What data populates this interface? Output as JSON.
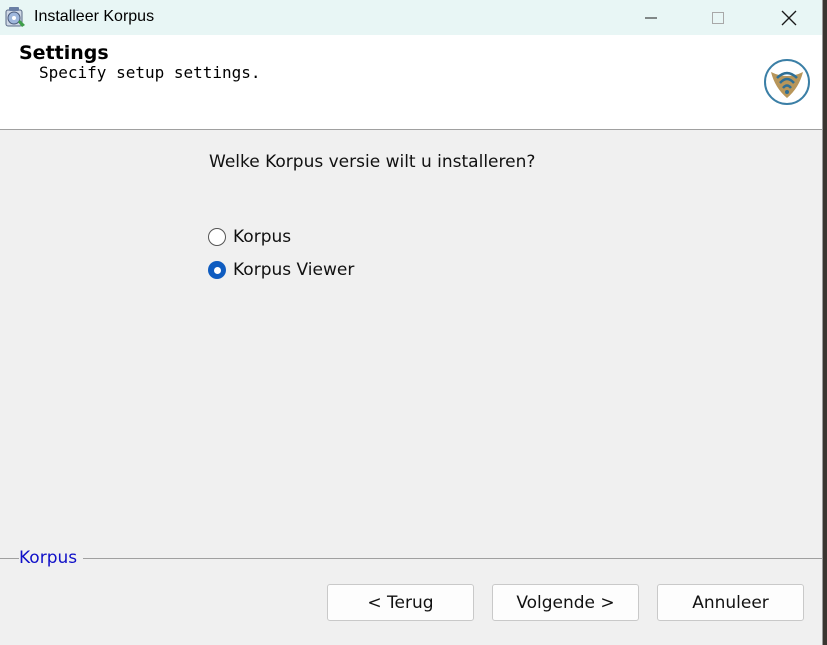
{
  "window": {
    "title": "Installeer Korpus",
    "icon": "installer-app-icon"
  },
  "header": {
    "title": "Settings",
    "subtitle": "Specify setup settings.",
    "logo": "korpus-logo-icon"
  },
  "main": {
    "question": "Welke Korpus versie wilt u installeren?",
    "options": [
      {
        "label": "Korpus",
        "selected": false
      },
      {
        "label": "Korpus Viewer",
        "selected": true
      }
    ]
  },
  "footer": {
    "group_label": "Korpus",
    "back_label": "< Terug",
    "next_label": "Volgende >",
    "cancel_label": "Annuleer"
  },
  "colors": {
    "accent": "#0f5cc0",
    "group_label": "#1010c8",
    "title_bar": "#e8f6f5"
  }
}
